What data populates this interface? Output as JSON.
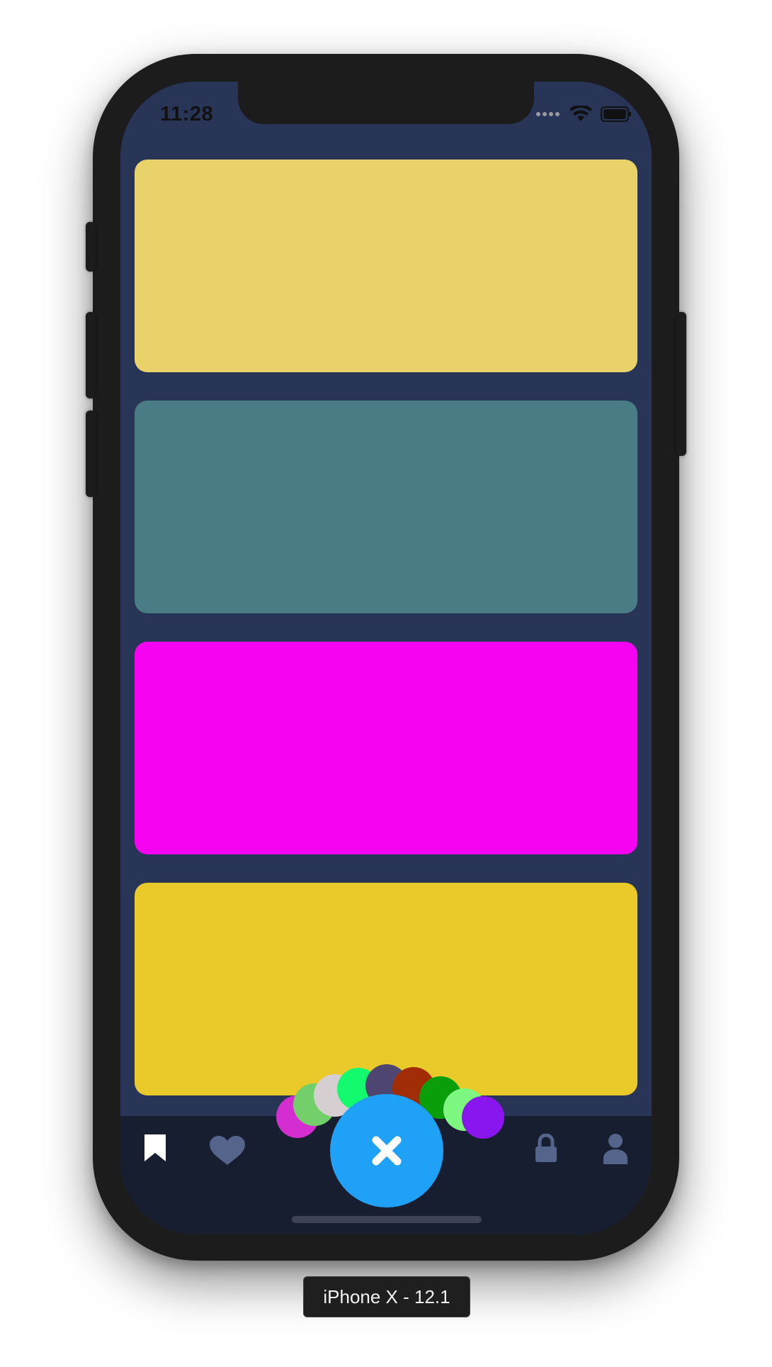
{
  "status_bar": {
    "time": "11:28"
  },
  "cards": [
    {
      "color": "#ead26a"
    },
    {
      "color": "#4a7c85"
    },
    {
      "color": "#f604f2"
    },
    {
      "color": "#eac92b"
    }
  ],
  "menu_dots": [
    {
      "color": "#d42ed0"
    },
    {
      "color": "#72cf6a"
    },
    {
      "color": "#d6cfd1"
    },
    {
      "color": "#13fa6f"
    },
    {
      "color": "#4e4670"
    },
    {
      "color": "#a12d07"
    },
    {
      "color": "#0b9e0b"
    },
    {
      "color": "#7df77f"
    },
    {
      "color": "#8916ee"
    }
  ],
  "tab_bar": {
    "items": [
      {
        "icon": "bookmark-icon",
        "active": true
      },
      {
        "icon": "heart-icon",
        "active": false
      },
      {
        "icon": "close-icon",
        "active": false
      },
      {
        "icon": "lock-icon",
        "active": false
      },
      {
        "icon": "user-icon",
        "active": false
      }
    ],
    "active_color": "#ffffff",
    "inactive_color": "#54648a",
    "fab_color": "#1ea1f7"
  },
  "simulator_label": "iPhone X - 12.1"
}
